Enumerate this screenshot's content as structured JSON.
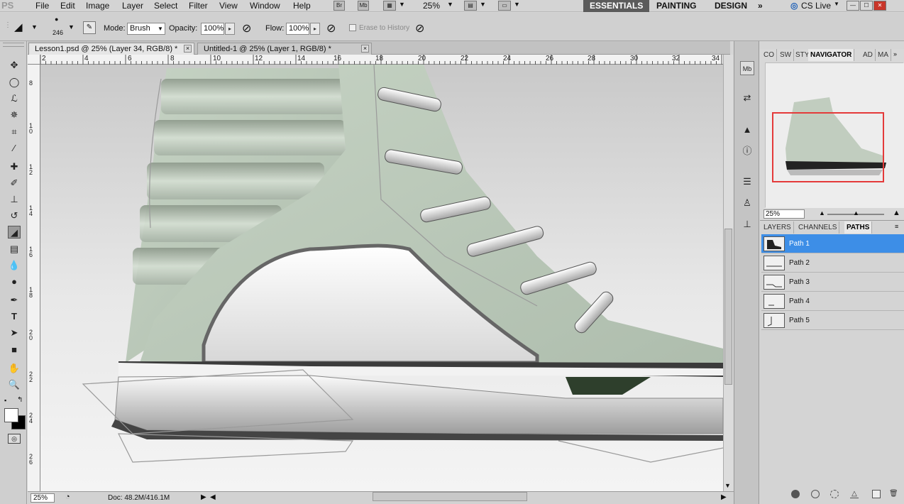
{
  "app": {
    "logo": "PS"
  },
  "menu": {
    "items": [
      "File",
      "Edit",
      "Image",
      "Layer",
      "Select",
      "Filter",
      "View",
      "Window",
      "Help"
    ],
    "bridge": "Br",
    "mini_bridge": "Mb",
    "zoom": "25%",
    "workspaces": [
      "ESSENTIALS",
      "PAINTING",
      "DESIGN"
    ],
    "more": "»",
    "cs_live": "CS Live"
  },
  "options": {
    "brush_size": "246",
    "mode_label": "Mode:",
    "mode_value": "Brush",
    "opacity_label": "Opacity:",
    "opacity_value": "100%",
    "flow_label": "Flow:",
    "flow_value": "100%",
    "erase_history": "Erase to History"
  },
  "tabs": [
    {
      "label": "Lesson1.psd @ 25% (Layer 34, RGB/8) *",
      "close": "×"
    },
    {
      "label": "Untitled-1 @ 25% (Layer 1, RGB/8) *",
      "close": "×"
    }
  ],
  "ruler": {
    "h": [
      "2",
      "4",
      "6",
      "8",
      "10",
      "12",
      "14",
      "16",
      "18",
      "20",
      "22",
      "24",
      "26",
      "28",
      "30",
      "32",
      "34"
    ],
    "v": [
      "8",
      "10",
      "12",
      "14",
      "16",
      "18",
      "20",
      "22",
      "24",
      "26"
    ]
  },
  "status": {
    "zoom": "25%",
    "doc": "Doc: 48.2M/416.1M"
  },
  "panels": {
    "top_tabs": [
      "CO",
      "SW",
      "STY",
      "NAVIGATOR",
      "AD",
      "MA"
    ],
    "navigator_zoom": "25%",
    "lower_tabs": [
      "LAYERS",
      "CHANNELS",
      "PATHS"
    ],
    "paths": [
      {
        "name": "Path 1",
        "selected": true
      },
      {
        "name": "Path 2",
        "selected": false
      },
      {
        "name": "Path 3",
        "selected": false
      },
      {
        "name": "Path 4",
        "selected": false
      },
      {
        "name": "Path 5",
        "selected": false
      }
    ]
  },
  "colors": {
    "accent": "#3d8ee7",
    "nav_box": "#e43a3a",
    "shoe_green": "#b9c7b8"
  }
}
